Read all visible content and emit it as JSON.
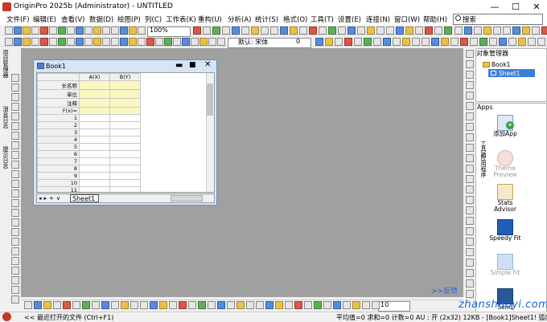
{
  "window": {
    "title": "OriginPro 2025b (Administrator) - UNTITLED",
    "minimize_label": "—",
    "maximize_label": "☐",
    "close_label": "✕"
  },
  "menus": [
    "文件(F)",
    "编辑(E)",
    "查看(V)",
    "数据(D)",
    "绘图(P)",
    "列(C)",
    "工作表(K)",
    "重构(U)",
    "分析(A)",
    "统计(S)",
    "格式(O)",
    "工具(T)",
    "设置(E)",
    "连接(N)",
    "窗口(W)",
    "帮助(H)"
  ],
  "search": {
    "label": "搜索"
  },
  "toolbar": {
    "zoom": "100%",
    "font": "默认: 宋体",
    "font_size": "0",
    "size_value": "10"
  },
  "left_panel": {
    "tab1": "项目管理器",
    "tab2": "消息日志",
    "tab3": "提示日志"
  },
  "book": {
    "title": "Book1",
    "columns": [
      "A(X)",
      "B(Y)"
    ],
    "row_labels": [
      "长名称",
      "单位",
      "注释",
      "F(x)="
    ],
    "rows": [
      "1",
      "2",
      "3",
      "4",
      "5",
      "6",
      "7",
      "8",
      "9",
      "10",
      "11"
    ],
    "sheet_tab": "Sheet1"
  },
  "object_manager": {
    "title": "对象管理器",
    "book": "Book1",
    "sheet": "Sheet1"
  },
  "apps": {
    "title": "Apps",
    "side_tabs": [
      "工具箱",
      "应用程序"
    ],
    "items": [
      {
        "label": "添加App",
        "icon": "add-app-icon"
      },
      {
        "label": "Theme Preview",
        "icon": "theme-preview-icon"
      },
      {
        "label": "Stats Advisor",
        "icon": "stats-advisor-icon"
      },
      {
        "label": "Speedy Fit",
        "icon": "speedy-fit-icon"
      },
      {
        "label": "Simple Fit",
        "icon": "simple-fit-icon"
      },
      {
        "label": "Send",
        "icon": "send-word-icon"
      }
    ]
  },
  "fx_link": ">>反馈",
  "status": {
    "left": "<< 最近打开的文件 (Ctrl+F1)",
    "right": "平均值=0 求和=0 计数=0   AU : 开   (2x32)   12KB - [Book1]Sheet1!  弧度"
  },
  "watermark": "zhanshaoyi.com"
}
